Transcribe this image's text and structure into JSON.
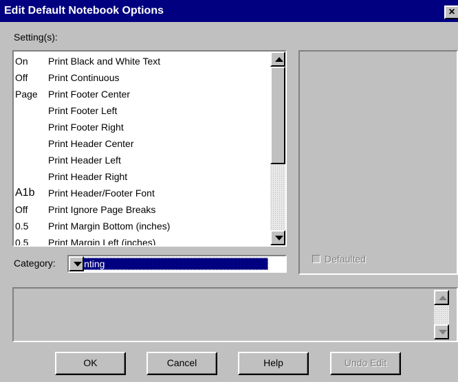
{
  "window": {
    "title": "Edit Default Notebook Options",
    "close_label": "×"
  },
  "settings": {
    "label": "Setting(s):",
    "rows": [
      {
        "value": "On",
        "name": "Print Black and White Text"
      },
      {
        "value": "Off",
        "name": "Print Continuous"
      },
      {
        "value": "Page",
        "name": "Print Footer Center"
      },
      {
        "value": "",
        "name": "Print Footer Left"
      },
      {
        "value": "",
        "name": "Print Footer Right"
      },
      {
        "value": "",
        "name": "Print Header Center"
      },
      {
        "value": "",
        "name": "Print Header Left"
      },
      {
        "value": "",
        "name": "Print Header Right"
      },
      {
        "value": "A1b",
        "name": "Print Header/Footer Font"
      },
      {
        "value": "Off",
        "name": "Print Ignore Page Breaks"
      },
      {
        "value": "0.5",
        "name": "Print Margin Bottom (inches)"
      },
      {
        "value": "0.5",
        "name": "Print Margin Left (inches)"
      }
    ]
  },
  "category": {
    "label": "Category:",
    "selected": "Printing"
  },
  "defaulted": {
    "label": "Defaulted",
    "checked": false,
    "enabled": false
  },
  "buttons": {
    "ok": "OK",
    "cancel": "Cancel",
    "help": "Help",
    "undo": "Undo Edit"
  },
  "colors": {
    "title_bar": "#000080",
    "face": "#c0c0c0",
    "selection": "#000080"
  }
}
